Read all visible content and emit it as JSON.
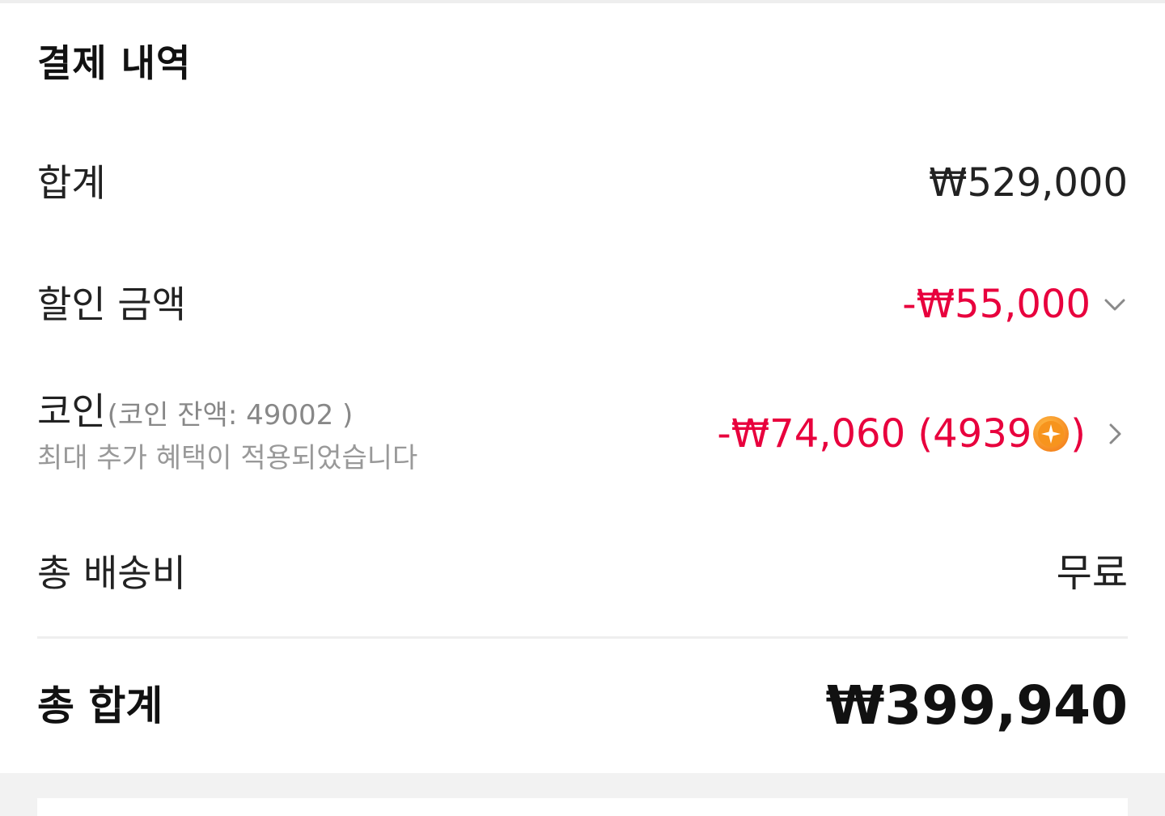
{
  "section": {
    "title": "결제 내역"
  },
  "rows": {
    "subtotal": {
      "label": "합계",
      "value": "₩529,000"
    },
    "discount": {
      "label": "할인 금액",
      "value": "-₩55,000",
      "icon": "chevron-down-icon"
    },
    "coin": {
      "label": "코인",
      "balance": "(코인 잔액: 49002 )",
      "note": "최대 추가 혜택이 적용되었습니다",
      "value_main": "-₩74,060 (4939",
      "value_close": ")",
      "icon": "coin-icon",
      "arrow": "chevron-right-icon"
    },
    "shipping": {
      "label": "총 배송비",
      "value": "무료"
    }
  },
  "total": {
    "label": "총 합계",
    "value": "₩399,940"
  },
  "colors": {
    "accent_red": "#e8003d",
    "coin_orange": "#f7941d",
    "text_primary": "#222222",
    "text_muted": "#999999"
  }
}
